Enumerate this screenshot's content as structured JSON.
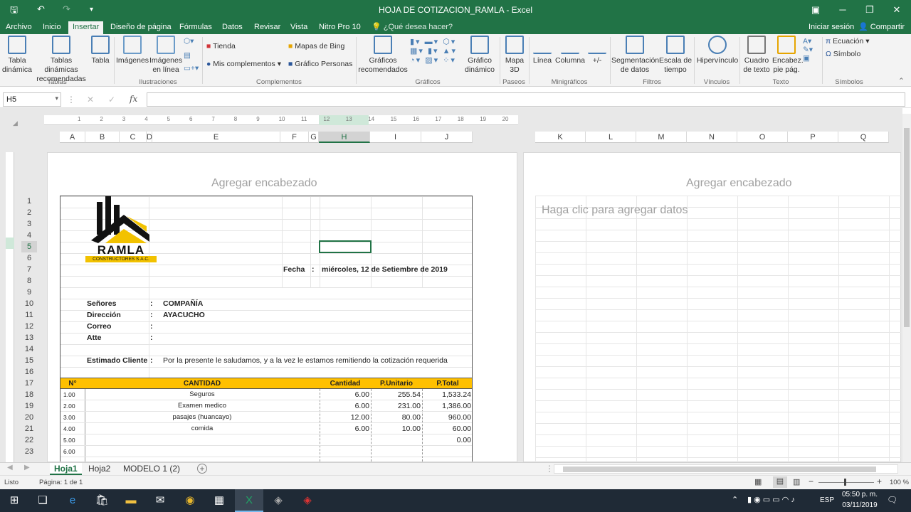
{
  "window": {
    "title": "HOJA DE COTIZACION_RAMLA - Excel",
    "quick_access": {
      "save": "🖫",
      "undo": "↶",
      "redo": "↷",
      "customize": "▾"
    },
    "controls": {
      "ribbon_options": "▣",
      "minimize": "─",
      "restore": "❐",
      "close": "✕"
    }
  },
  "menu": {
    "tabs": [
      "Archivo",
      "Inicio",
      "Insertar",
      "Diseño de página",
      "Fórmulas",
      "Datos",
      "Revisar",
      "Vista",
      "Nitro Pro 10"
    ],
    "tell_me": "¿Qué desea hacer?",
    "sign_in": "Iniciar sesión",
    "share": "Compartir"
  },
  "ribbon": {
    "tabla_dinamica": "Tabla dinámica",
    "tablas_recomendadas": "Tablas dinámicas recomendadas",
    "tabla": "Tabla",
    "imagenes": "Imágenes",
    "imagenes_linea": "Imágenes en línea",
    "tienda": "Tienda",
    "mis_complementos": "Mis complementos",
    "mapas_bing": "Mapas de Bing",
    "grafico_personas": "Gráfico Personas",
    "graficos_recomendados": "Gráficos recomendados",
    "grafico_dinamico": "Gráfico dinámico",
    "mapa3d": "Mapa 3D",
    "linea": "Línea",
    "columna": "Columna",
    "ganancia": "+/-",
    "segmentacion": "Segmentación de datos",
    "escala_tiempo": "Escala de tiempo",
    "hipervinculo": "Hipervínculo",
    "cuadro_texto": "Cuadro de texto",
    "encabezado": "Encabez. pie pág.",
    "ecuacion": "Ecuación",
    "simbolo": "Símbolo",
    "groups": {
      "tablas": "Tablas",
      "ilustraciones": "Ilustraciones",
      "complementos": "Complementos",
      "graficos": "Gráficos",
      "paseos": "Paseos",
      "minigraficos": "Minigráficos",
      "filtros": "Filtros",
      "vinculos": "Vínculos",
      "texto": "Texto",
      "simbolos": "Símbolos"
    }
  },
  "formula_bar": {
    "name_box": "H5",
    "fx": "fx",
    "cancel": "✕",
    "enter": "✓",
    "value": ""
  },
  "ruler": [
    "1",
    "2",
    "3",
    "4",
    "5",
    "6",
    "7",
    "8",
    "9",
    "10",
    "11",
    "12",
    "13",
    "14",
    "15",
    "16",
    "17",
    "18",
    "19",
    "20"
  ],
  "columns": [
    "A",
    "B",
    "C",
    "D",
    "E",
    "F",
    "G",
    "H",
    "I",
    "J",
    "K",
    "L",
    "M",
    "N",
    "O",
    "P",
    "Q"
  ],
  "rows": [
    "1",
    "2",
    "3",
    "4",
    "5",
    "6",
    "7",
    "8",
    "9",
    "10",
    "11",
    "12",
    "13",
    "14",
    "15",
    "16",
    "17",
    "18",
    "19",
    "20",
    "21",
    "22",
    "23"
  ],
  "page": {
    "header_hint": "Agregar encabezado",
    "header_hint2": "Agregar encabezado",
    "data_hint": "Haga clic para agregar datos"
  },
  "logo": {
    "name": "RAMLA",
    "sub": "CONSTRUCTORES S.A.C."
  },
  "sheet": {
    "fecha_label": "Fecha",
    "sep": ":",
    "fecha_value": "miércoles, 12 de Setiembre de 2019",
    "senores_label": "Señores",
    "senores_value": "COMPAÑÍA",
    "direccion_label": "Dirección",
    "direccion_value": "AYACUCHO",
    "correo_label": "Correo",
    "atte_label": "Atte",
    "estimado_label": "Estimado Cliente",
    "estimado_value": "Por la presente le saludamos, y a la vez le estamos remitiendo la cotización requerida",
    "table_headers": [
      "N°",
      "CANTIDAD",
      "Cantidad",
      "P.Unitario",
      "P.Total"
    ],
    "table_rows": [
      {
        "n": "1.00",
        "desc": "Seguros",
        "cant": "6.00",
        "pu": "255.54",
        "pt": "1,533.24"
      },
      {
        "n": "2.00",
        "desc": "Examen medico",
        "cant": "6.00",
        "pu": "231.00",
        "pt": "1,386.00"
      },
      {
        "n": "3.00",
        "desc": "pasajes (huancayo)",
        "cant": "12.00",
        "pu": "80.00",
        "pt": "960.00"
      },
      {
        "n": "4.00",
        "desc": "comida",
        "cant": "6.00",
        "pu": "10.00",
        "pt": "60.00"
      },
      {
        "n": "5.00",
        "desc": "",
        "cant": "",
        "pu": "",
        "pt": "0.00"
      },
      {
        "n": "6.00",
        "desc": "",
        "cant": "",
        "pu": "",
        "pt": ""
      }
    ]
  },
  "sheet_tabs": [
    "Hoja1",
    "Hoja2",
    "MODELO 1 (2)"
  ],
  "status": {
    "ready": "Listo",
    "page": "Página: 1 de 1",
    "zoom": "100 %"
  },
  "taskbar": {
    "time": "05:50 p. m.",
    "date": "03/11/2019",
    "lang": "ESP"
  },
  "colors": {
    "excel_green": "#217346",
    "table_header": "#ffc000"
  }
}
